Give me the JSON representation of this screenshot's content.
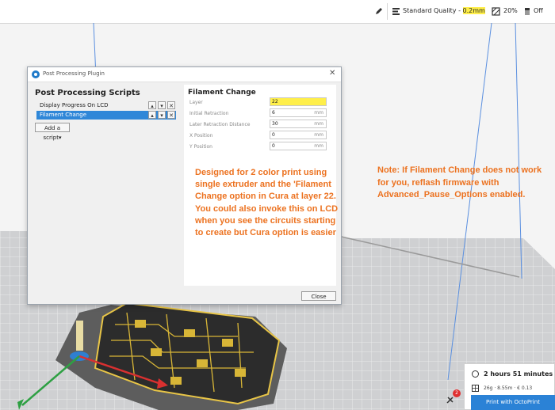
{
  "topbar": {
    "quality_prefix": "Standard Quality - ",
    "quality_layer": "0.2mm",
    "infill": "20%",
    "support": "Off"
  },
  "dialog": {
    "title": "Post Processing Plugin",
    "close_glyph": "✕",
    "left_title": "Post Processing Scripts",
    "scripts": [
      {
        "label": "Display Progress On LCD"
      },
      {
        "label": "Filament Change"
      }
    ],
    "script_buttons": {
      "up": "▴",
      "down": "▾",
      "remove": "✕"
    },
    "add_script_label": "Add a script▾",
    "right_title": "Filament Change",
    "fields": [
      {
        "label": "Layer",
        "value": "22",
        "unit": ""
      },
      {
        "label": "Initial Retraction",
        "value": "6",
        "unit": "mm"
      },
      {
        "label": "Later Retraction Distance",
        "value": "30",
        "unit": "mm"
      },
      {
        "label": "X Position",
        "value": "0",
        "unit": "mm"
      },
      {
        "label": "Y Position",
        "value": "0",
        "unit": "mm"
      }
    ],
    "close_label": "Close"
  },
  "annotations": {
    "note1": "Designed for 2 color print using single extruder and the 'Filament Change option in Cura at layer 22. You could also invoke this on LCD when you see the circuits starting to create but Cura option is easier",
    "note2": "Note: If Filament Change does not work for you, reflash firmware with Advanced_Pause_Options enabled."
  },
  "print_panel": {
    "time": "2 hours 51 minutes",
    "material": "26g · 8.55m · € 0.13",
    "print_button": "Print with OctoPrint",
    "badge": "2"
  },
  "icons": {
    "pencil": "pencil-icon",
    "quality": "quality-profile-icon",
    "infill": "infill-icon",
    "support": "support-icon",
    "clock": "clock-icon",
    "material": "material-icon",
    "monitor": "monitor-icon",
    "logo": "cura-logo-icon"
  },
  "colors": {
    "accent_blue": "#2b82d6",
    "annotation_orange": "#ec7220",
    "highlight_yellow": "#ffef4a"
  }
}
